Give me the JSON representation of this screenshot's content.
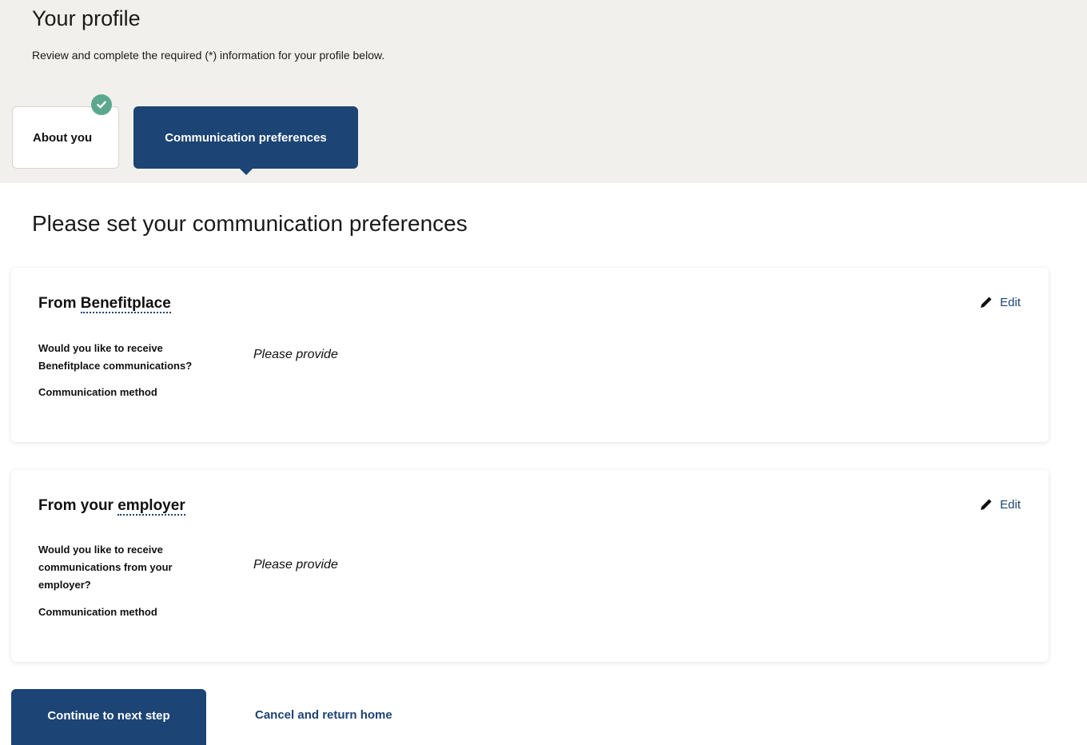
{
  "header": {
    "title": "Your profile",
    "subtitle": "Review and complete the required (*) information for your profile below."
  },
  "tabs": [
    {
      "label": "About you",
      "state": "completed",
      "icon": "check-icon"
    },
    {
      "label": "Communication preferences",
      "state": "active"
    }
  ],
  "main": {
    "heading": "Please set your communication preferences"
  },
  "cards": [
    {
      "title_prefix": "From",
      "title_term": "Benefitplace",
      "edit_label": "Edit",
      "edit_icon": "pencil-icon",
      "question": "Would you like to receive Benefitplace communications?",
      "answer": "Please provide",
      "method_label": "Communication method"
    },
    {
      "title_prefix": "From your",
      "title_term": "employer",
      "edit_label": "Edit",
      "edit_icon": "pencil-icon",
      "question": "Would you like to receive communications from your employer?",
      "answer": "Please provide",
      "method_label": "Communication method"
    }
  ],
  "actions": {
    "continue_label": "Continue to next step",
    "cancel_label": "Cancel and return home"
  },
  "colors": {
    "primary": "#1c4474",
    "header_bg": "#f2f0ec",
    "success": "#5ba88f"
  }
}
